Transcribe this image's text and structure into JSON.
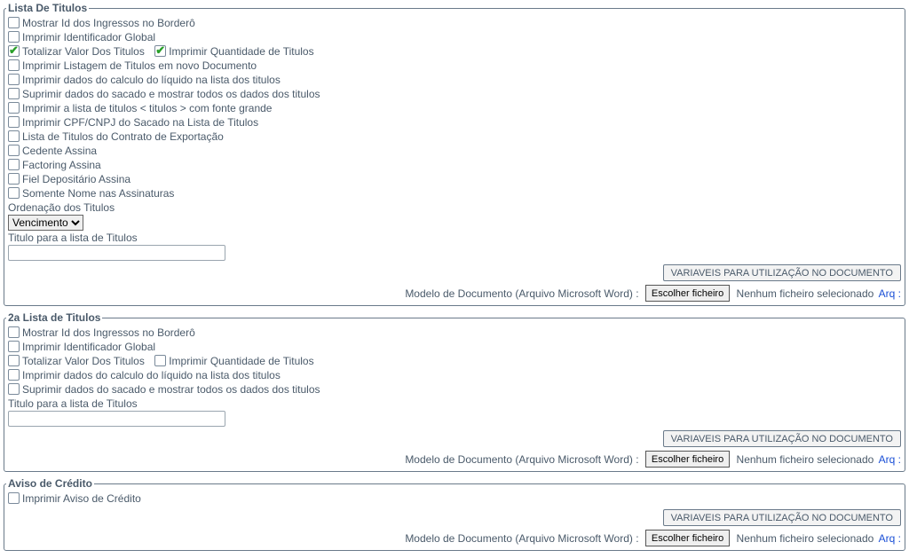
{
  "common": {
    "variables_button": "VARIAVEIS PARA UTILIZAÇÃO NO DOCUMENTO",
    "model_label": "Modelo de Documento (Arquivo Microsoft Word) :",
    "choose_file": "Escolher ficheiro",
    "no_file": "Nenhum ficheiro selecionado",
    "arq": "Arq :"
  },
  "section1": {
    "legend": "Lista De Titulos",
    "cb_mostrar_id": "Mostrar Id dos Ingressos no Borderô",
    "cb_imprimir_ident": "Imprimir Identificador Global",
    "cb_totalizar": "Totalizar Valor Dos Titulos",
    "cb_imprimir_qtd": "Imprimir Quantidade de Titulos",
    "cb_imprimir_listagem": "Imprimir Listagem de Titulos em novo Documento",
    "cb_imprimir_dados_calc": "Imprimir dados do calculo do líquido na lista dos titulos",
    "cb_suprimir_dados": "Suprimir dados do sacado e mostrar todos os dados dos titulos",
    "cb_imprimir_lista_fonte": "Imprimir a lista de titulos < titulos > com fonte grande",
    "cb_imprimir_cpf": "Imprimir CPF/CNPJ do Sacado na Lista de Titulos",
    "cb_lista_contrato": "Lista de Titulos do Contrato de Exportação",
    "cb_cedente_assina": "Cedente Assina",
    "cb_factoring_assina": "Factoring Assina",
    "cb_fiel_dep": "Fiel Depositário Assina",
    "cb_somente_nome": "Somente Nome nas Assinaturas",
    "ordenacao_label": "Ordenação dos Titulos",
    "ordenacao_value": "Vencimento",
    "titulo_lista_label": "Titulo para a lista de Titulos"
  },
  "section2": {
    "legend": "2a Lista de Titulos",
    "cb_mostrar_id": "Mostrar Id dos Ingressos no Borderô",
    "cb_imprimir_ident": "Imprimir Identificador Global",
    "cb_totalizar": "Totalizar Valor Dos Titulos",
    "cb_imprimir_qtd": "Imprimir Quantidade de Titulos",
    "cb_imprimir_dados_calc": "Imprimir dados do calculo do líquido na lista dos titulos",
    "cb_suprimir_dados": "Suprimir dados do sacado e mostrar todos os dados dos titulos",
    "titulo_lista_label": "Titulo para a lista de Titulos"
  },
  "section3": {
    "legend": "Aviso de Crédito",
    "cb_imprimir_aviso": "Imprimir Aviso de Crédito"
  }
}
